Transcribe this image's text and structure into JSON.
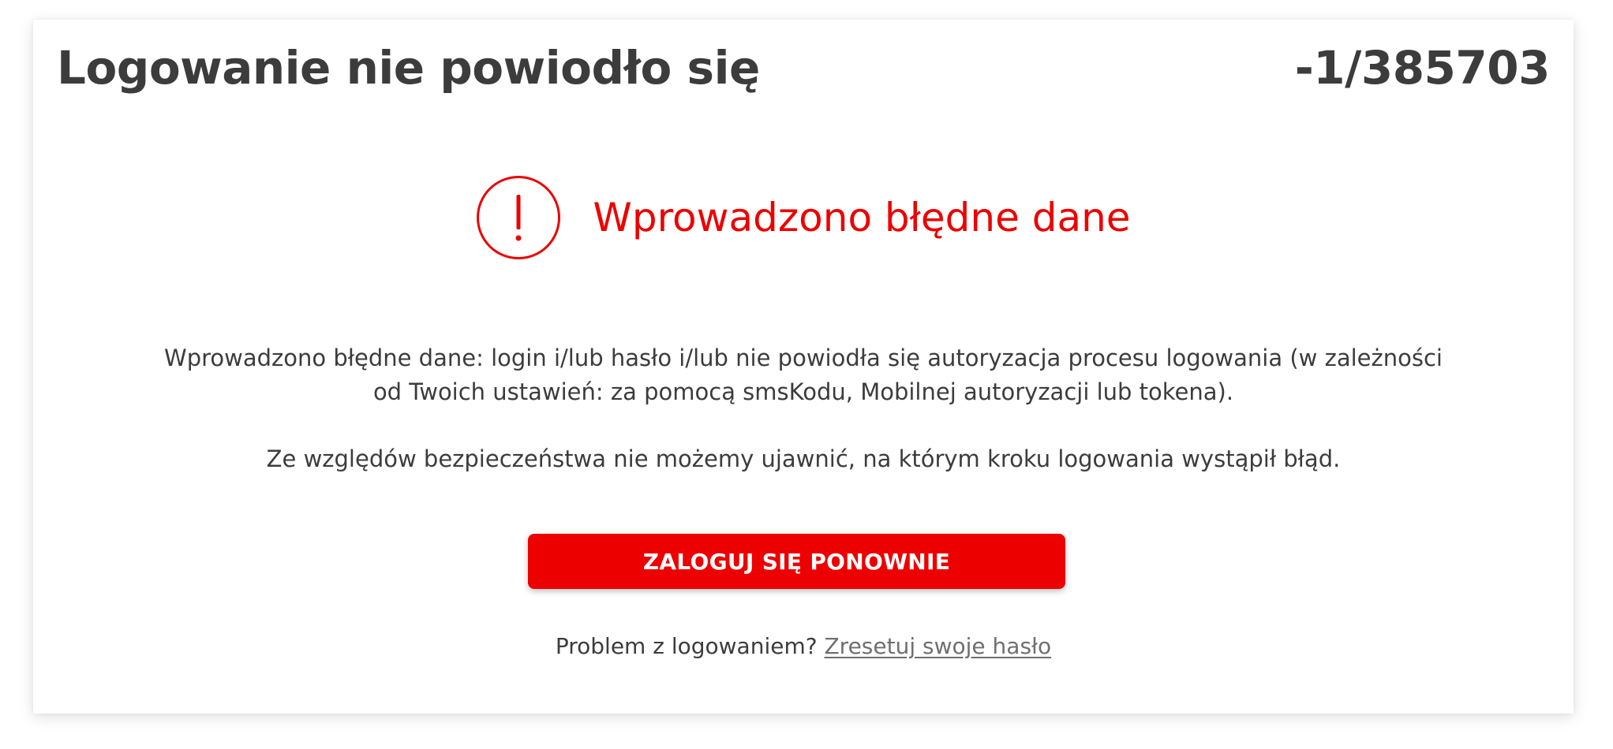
{
  "header": {
    "title": "Logowanie nie powiodło się",
    "error_code": "-1/385703"
  },
  "alert": {
    "icon": "exclamation-circle-icon",
    "heading": "Wprowadzono błędne dane",
    "color": "#ec0000"
  },
  "message": {
    "paragraph_1": "Wprowadzono błędne dane: login i/lub hasło i/lub nie powiodła się autoryzacja procesu logowania (w zależności od Twoich ustawień: za pomocą smsKodu, Mobilnej autoryzacji lub tokena).",
    "paragraph_2": "Ze względów bezpieczeństwa nie możemy ujawnić, na którym kroku logowania wystąpił błąd."
  },
  "actions": {
    "retry_label": "ZALOGUJ SIĘ PONOWNIE",
    "help_text": "Problem z logowaniem?",
    "reset_link_label": "Zresetuj swoje hasło"
  },
  "colors": {
    "brand_red": "#ec0000",
    "text_dark": "#3c3c3c",
    "link_gray": "#6f6f6f"
  }
}
